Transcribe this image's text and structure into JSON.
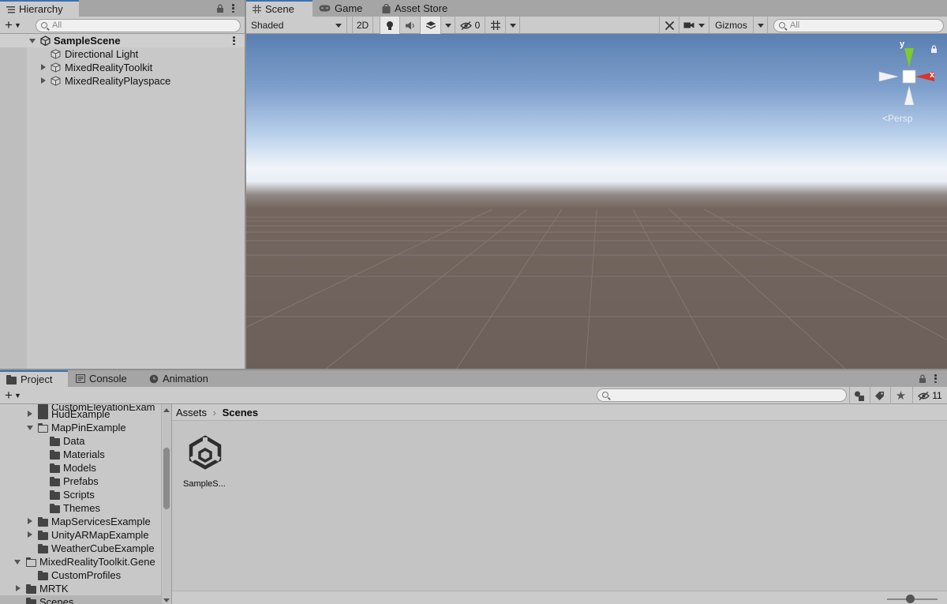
{
  "hierarchy": {
    "tab_label": "Hierarchy",
    "search_placeholder": "All",
    "scene_name": "SampleScene",
    "items": [
      {
        "label": "Directional Light",
        "expandable": false
      },
      {
        "label": "MixedRealityToolkit",
        "expandable": true
      },
      {
        "label": "MixedRealityPlayspace",
        "expandable": true
      }
    ]
  },
  "scene_view": {
    "tabs": [
      {
        "label": "Scene",
        "icon": "grid-icon",
        "active": true
      },
      {
        "label": "Game",
        "icon": "gamepad-icon",
        "active": false
      },
      {
        "label": "Asset Store",
        "icon": "bag-icon",
        "active": false
      }
    ],
    "shading_mode": "Shaded",
    "mode_2d": "2D",
    "hidden_count": "0",
    "gizmos_label": "Gizmos",
    "search_placeholder": "All",
    "gizmo_axes": {
      "x": "x",
      "y": "y"
    },
    "projection_label": "Persp",
    "colors": {
      "sky_top": "#5a7fb0",
      "horizon": "#f4f7fb",
      "ground": "#6c5f5a",
      "axis_x": "#d9342b",
      "axis_y": "#7ccb2e"
    }
  },
  "project": {
    "tabs": [
      {
        "label": "Project",
        "icon": "folder-icon",
        "active": true
      },
      {
        "label": "Console",
        "icon": "console-icon",
        "active": false
      },
      {
        "label": "Animation",
        "icon": "clock-icon",
        "active": false
      }
    ],
    "hidden_packages_count": "11",
    "tree": [
      {
        "label": "CustomElevationExam",
        "indent": 2,
        "type": "folder",
        "arrow": "none",
        "partial": true
      },
      {
        "label": "HudExample",
        "indent": 2,
        "type": "folder",
        "arrow": "right"
      },
      {
        "label": "MapPinExample",
        "indent": 2,
        "type": "folder-open",
        "arrow": "down"
      },
      {
        "label": "Data",
        "indent": 3,
        "type": "folder",
        "arrow": "none"
      },
      {
        "label": "Materials",
        "indent": 3,
        "type": "folder",
        "arrow": "none"
      },
      {
        "label": "Models",
        "indent": 3,
        "type": "folder",
        "arrow": "none"
      },
      {
        "label": "Prefabs",
        "indent": 3,
        "type": "folder",
        "arrow": "none"
      },
      {
        "label": "Scripts",
        "indent": 3,
        "type": "folder",
        "arrow": "none"
      },
      {
        "label": "Themes",
        "indent": 3,
        "type": "folder",
        "arrow": "none"
      },
      {
        "label": "MapServicesExample",
        "indent": 2,
        "type": "folder",
        "arrow": "right"
      },
      {
        "label": "UnityARMapExample",
        "indent": 2,
        "type": "folder",
        "arrow": "right"
      },
      {
        "label": "WeatherCubeExample",
        "indent": 2,
        "type": "folder",
        "arrow": "none"
      },
      {
        "label": "MixedRealityToolkit.Gene",
        "indent": 1,
        "type": "folder-open",
        "arrow": "down"
      },
      {
        "label": "CustomProfiles",
        "indent": 2,
        "type": "folder",
        "arrow": "none"
      },
      {
        "label": "MRTK",
        "indent": 1,
        "type": "folder",
        "arrow": "right"
      },
      {
        "label": "Scenes",
        "indent": 1,
        "type": "folder",
        "arrow": "none",
        "selected": true
      }
    ],
    "breadcrumb": {
      "root": "Assets",
      "separator": "›",
      "current": "Scenes"
    },
    "assets": [
      {
        "label": "SampleS...",
        "icon": "unity-logo-icon"
      }
    ]
  }
}
